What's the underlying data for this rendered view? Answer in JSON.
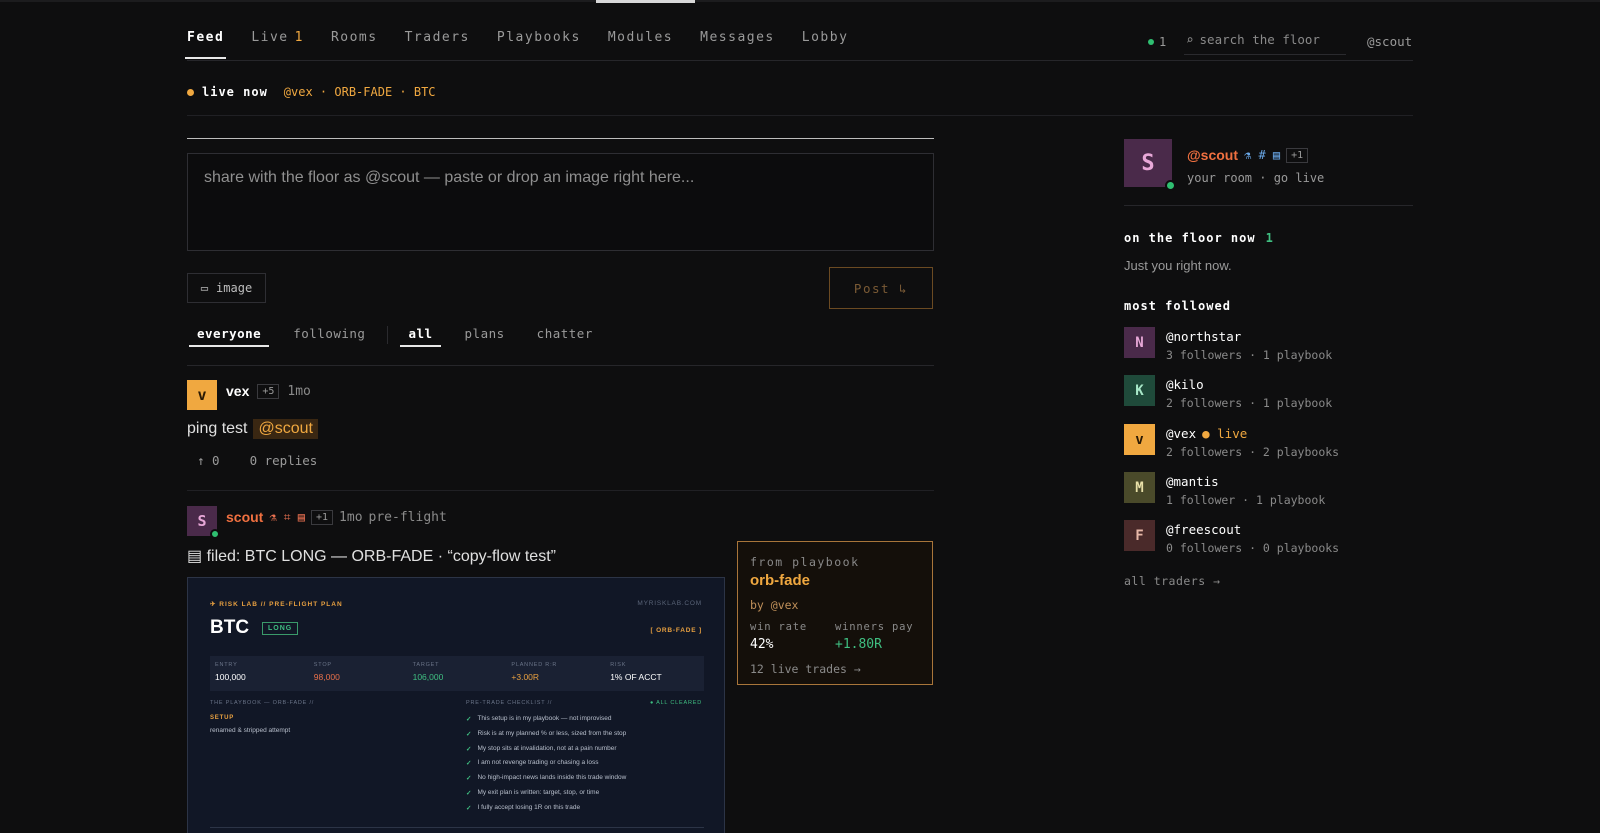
{
  "nav": {
    "items": [
      {
        "label": "Feed",
        "active": true
      },
      {
        "label": "Live",
        "badge": "1"
      },
      {
        "label": "Rooms"
      },
      {
        "label": "Traders"
      },
      {
        "label": "Playbooks"
      },
      {
        "label": "Modules"
      },
      {
        "label": "Messages"
      },
      {
        "label": "Lobby"
      }
    ],
    "online_count": "1",
    "search_placeholder": "search the floor",
    "search_icon": "⌕",
    "user_handle": "@scout"
  },
  "live_now": {
    "label": "live now",
    "meta": "@vex · ORB-FADE · BTC"
  },
  "composer": {
    "placeholder": "share with the floor as @scout — paste or drop an image right here...",
    "image_label": "image",
    "image_icon": "▭",
    "post_label": "Post ↳"
  },
  "filters": {
    "audience": [
      {
        "label": "everyone",
        "active": true
      },
      {
        "label": "following",
        "active": false
      }
    ],
    "type": [
      {
        "label": "all",
        "active": true
      },
      {
        "label": "plans",
        "active": false
      },
      {
        "label": "chatter",
        "active": false
      }
    ]
  },
  "posts": [
    {
      "avatar": "v",
      "author": "vex",
      "tag": "+5",
      "time": "1mo",
      "body": "ping test",
      "mention": "@scout",
      "upvotes": "↑ 0",
      "replies": "0 replies"
    },
    {
      "avatar": "S",
      "author": "scout",
      "icons": "⚗ ⌗ ▤",
      "tag": "+1",
      "time": "1mo",
      "label": "pre-flight",
      "title": "▤ filed: BTC LONG — ORB-FADE · “copy-flow test”"
    }
  ],
  "plan_image": {
    "header": "✈ RISK LAB // PRE-FLIGHT PLAN",
    "site": "MYRISKLAB.COM",
    "symbol": "BTC",
    "direction": "LONG",
    "playbook": "[ ORB-FADE ]",
    "stats": [
      {
        "k": "ENTRY",
        "v": "100,000",
        "color": "#ffffff"
      },
      {
        "k": "STOP",
        "v": "98,000",
        "color": "#e8704a"
      },
      {
        "k": "TARGET",
        "v": "106,000",
        "color": "#3fbf81"
      },
      {
        "k": "PLANNED R:R",
        "v": "+3.00R",
        "color": "#e8a040"
      },
      {
        "k": "RISK",
        "v": "1% OF ACCT",
        "color": "#ffffff"
      }
    ],
    "left_heading": "THE PLAYBOOK — ORB-FADE //",
    "setup_label": "SETUP",
    "setup_text": "renamed & stripped attempt",
    "right_heading": "PRE-TRADE CHECKLIST //",
    "cleared": "● ALL CLEARED",
    "checklist": [
      "This setup is in my playbook — not improvised",
      "Risk is at my planned % or less, sized from the stop",
      "My stop sits at invalidation, not at a pain number",
      "I am not revenge trading or chasing a loss",
      "No high-impact news lands inside this trade window",
      "My exit plan is written: target, stop, or time",
      "I fully accept losing 1R on this trade"
    ]
  },
  "playbook_card": {
    "kicker": "from playbook",
    "name": "orb-fade",
    "by": "by @vex",
    "win_rate_label": "win rate",
    "win_rate": "42%",
    "winners_label": "winners pay",
    "winners": "+1.80R",
    "trades": "12 live trades →"
  },
  "sidebar": {
    "me": {
      "avatar": "S",
      "handle": "@scout",
      "icons": "⚗ # ▤",
      "tag": "+1",
      "sub": "your room · go live"
    },
    "floor_heading": "on the floor now",
    "floor_count": "1",
    "floor_text": "Just you right now.",
    "most_followed_heading": "most followed",
    "traders": [
      {
        "avatar": "N",
        "name": "@northstar",
        "meta": "3 followers · 1 playbook",
        "bg": "#4a2a4a",
        "fg": "#e8a8d8",
        "live": ""
      },
      {
        "avatar": "K",
        "name": "@kilo",
        "meta": "2 followers · 1 playbook",
        "bg": "#1f4a3a",
        "fg": "#a8e8c8",
        "live": ""
      },
      {
        "avatar": "v",
        "name": "@vex",
        "meta": "2 followers · 2 playbooks",
        "bg": "#f0a840",
        "fg": "#2a1a05",
        "live": "● live"
      },
      {
        "avatar": "M",
        "name": "@mantis",
        "meta": "1 follower · 1 playbook",
        "bg": "#4a4a2a",
        "fg": "#e8e0a8",
        "live": ""
      },
      {
        "avatar": "F",
        "name": "@freescout",
        "meta": "0 followers · 0 playbooks",
        "bg": "#4a2a2a",
        "fg": "#e8b8a8",
        "live": ""
      }
    ],
    "all_traders": "all traders →"
  }
}
